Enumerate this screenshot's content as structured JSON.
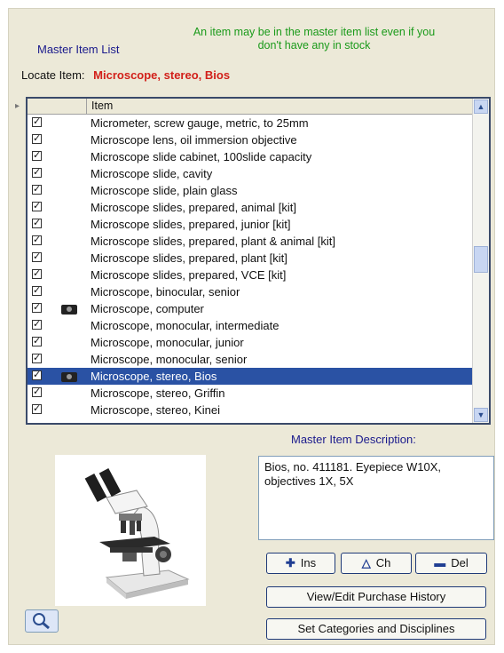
{
  "header": {
    "title": "Master Item List",
    "notice": "An item may be in the master item list even if you don't have any in stock",
    "locate_label": "Locate Item:",
    "locate_value": "Microscope, stereo, Bios"
  },
  "grid": {
    "column_header": "Item",
    "rows": [
      {
        "name": "Micrometer, screw gauge, metric, to 25mm",
        "checked": true,
        "camera": false,
        "selected": false
      },
      {
        "name": "Microscope lens, oil immersion objective",
        "checked": true,
        "camera": false,
        "selected": false
      },
      {
        "name": "Microscope slide cabinet, 100slide capacity",
        "checked": true,
        "camera": false,
        "selected": false
      },
      {
        "name": "Microscope slide, cavity",
        "checked": true,
        "camera": false,
        "selected": false
      },
      {
        "name": "Microscope slide, plain glass",
        "checked": true,
        "camera": false,
        "selected": false
      },
      {
        "name": "Microscope slides, prepared, animal [kit]",
        "checked": true,
        "camera": false,
        "selected": false
      },
      {
        "name": "Microscope slides, prepared, junior [kit]",
        "checked": true,
        "camera": false,
        "selected": false
      },
      {
        "name": "Microscope slides, prepared, plant & animal [kit]",
        "checked": true,
        "camera": false,
        "selected": false
      },
      {
        "name": "Microscope slides, prepared, plant [kit]",
        "checked": true,
        "camera": false,
        "selected": false
      },
      {
        "name": "Microscope slides, prepared, VCE [kit]",
        "checked": true,
        "camera": false,
        "selected": false
      },
      {
        "name": "Microscope, binocular, senior",
        "checked": true,
        "camera": false,
        "selected": false
      },
      {
        "name": "Microscope, computer",
        "checked": true,
        "camera": true,
        "selected": false
      },
      {
        "name": "Microscope, monocular, intermediate",
        "checked": true,
        "camera": false,
        "selected": false
      },
      {
        "name": "Microscope, monocular, junior",
        "checked": true,
        "camera": false,
        "selected": false
      },
      {
        "name": "Microscope, monocular, senior",
        "checked": true,
        "camera": false,
        "selected": false
      },
      {
        "name": "Microscope, stereo, Bios",
        "checked": true,
        "camera": true,
        "selected": true
      },
      {
        "name": "Microscope, stereo, Griffin",
        "checked": true,
        "camera": false,
        "selected": false
      },
      {
        "name": "Microscope, stereo, Kinei",
        "checked": true,
        "camera": false,
        "selected": false
      }
    ]
  },
  "description": {
    "label": "Master Item Description:",
    "text": "Bios, no. 411181. Eyepiece W10X, objectives 1X, 5X"
  },
  "buttons": {
    "ins": "Ins",
    "ch": "Ch",
    "del": "Del",
    "history": "View/Edit Purchase History",
    "categories": "Set Categories and Disciplines"
  },
  "icons": {
    "check": "checkmark-icon",
    "camera": "camera-icon",
    "plus": "plus-icon",
    "triangle": "triangle-icon",
    "minus": "minus-icon",
    "magnifier": "magnifier-icon",
    "image": "microscope-image"
  }
}
